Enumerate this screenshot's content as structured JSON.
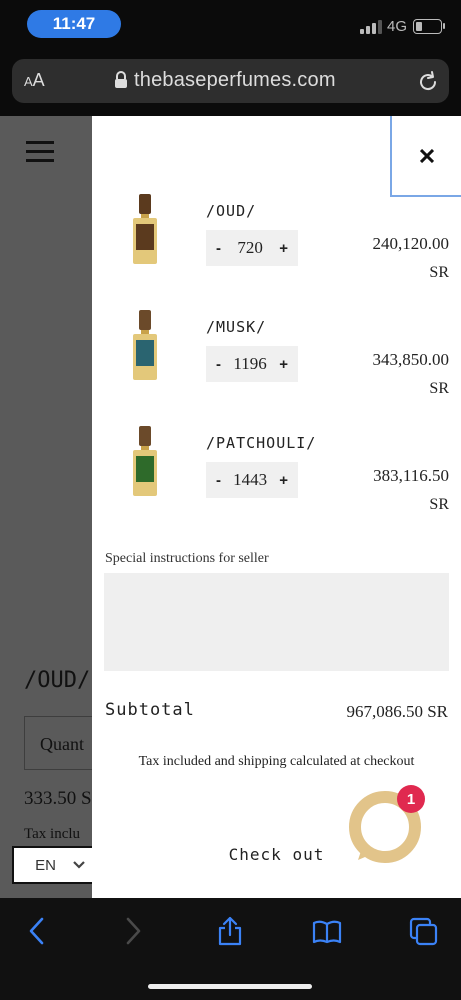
{
  "status_bar": {
    "time": "11:47",
    "network": "4G"
  },
  "browser": {
    "text_size_label_small": "A",
    "text_size_label_big": "A",
    "url": "thebaseperfumes.com"
  },
  "background_page": {
    "product_title": "/OUD/",
    "quantity_label": "Quant",
    "price": "333.50 S",
    "tax_note": "Tax inclu",
    "language": "EN"
  },
  "cart": {
    "items": [
      {
        "name": "/OUD/",
        "minus": "-",
        "quantity": "720",
        "plus": "+",
        "price": "240,120.00",
        "currency": "SR",
        "label_color": "#5b3a1e"
      },
      {
        "name": "/MUSK/",
        "minus": "-",
        "quantity": "1196",
        "plus": "+",
        "price": "343,850.00",
        "currency": "SR",
        "label_color": "#2a6470"
      },
      {
        "name": "/PATCHOULI/",
        "minus": "-",
        "quantity": "1443",
        "plus": "+",
        "price": "383,116.50",
        "currency": "SR",
        "label_color": "#2e6a2a"
      }
    ],
    "instructions_label": "Special instructions for seller",
    "subtotal_label": "Subtotal",
    "subtotal_value": "967,086.50 SR",
    "tax_note": "Tax included and shipping calculated at checkout",
    "checkout_label": "Check out",
    "chat_badge": "1"
  },
  "colors": {
    "accent_blue": "#2f7ae5",
    "chat_ring": "#e2c48a",
    "badge_red": "#e0294f"
  }
}
